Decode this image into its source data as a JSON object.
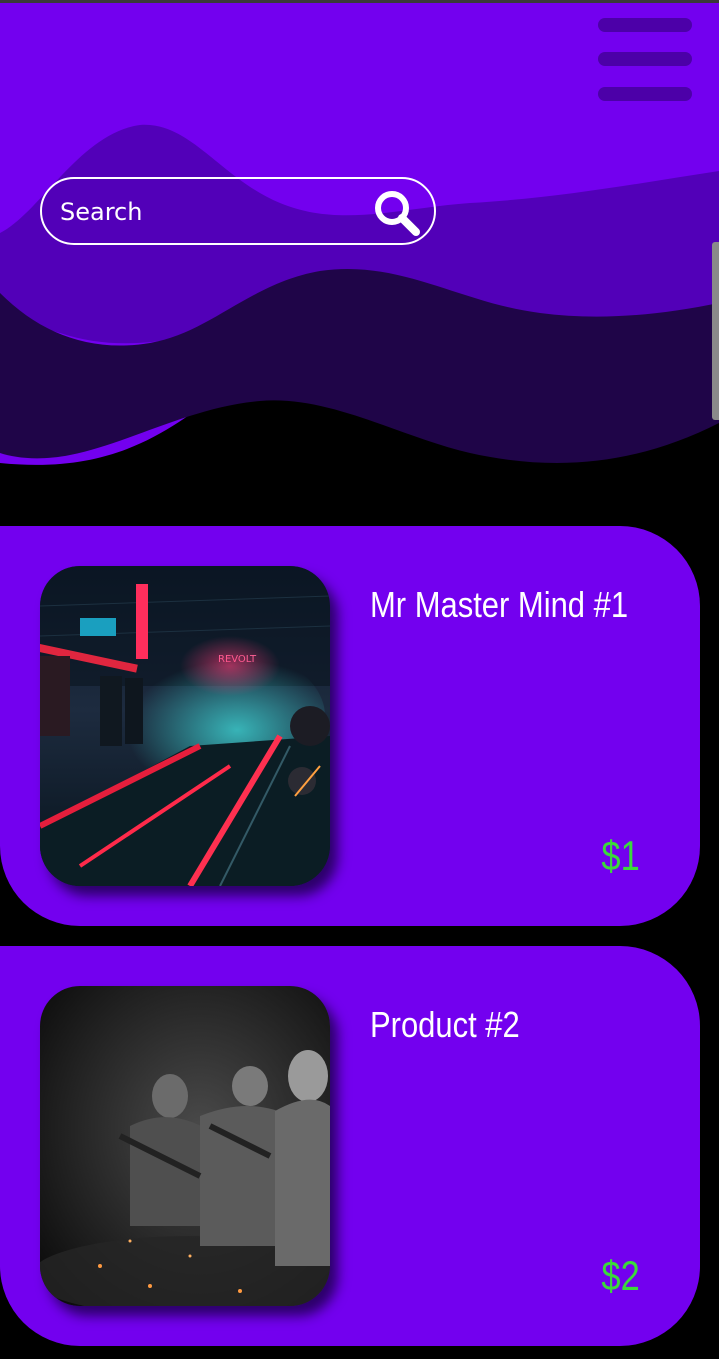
{
  "search": {
    "placeholder": "Search"
  },
  "colors": {
    "header_light": "#7300ef",
    "header_mid": "#5200b8",
    "header_dark": "#1f0548",
    "card_background": "#7300ef",
    "price_color": "#3bd93b",
    "page_background": "#000000"
  },
  "icons": {
    "menu": "hamburger-menu-icon",
    "search": "magnifying-glass-icon"
  },
  "products": [
    {
      "title": "Mr Master Mind #1",
      "price": "$1",
      "image": "neon-cyberpunk-street"
    },
    {
      "title": "Product #2",
      "price": "$2",
      "image": "soldiers-squad"
    }
  ]
}
